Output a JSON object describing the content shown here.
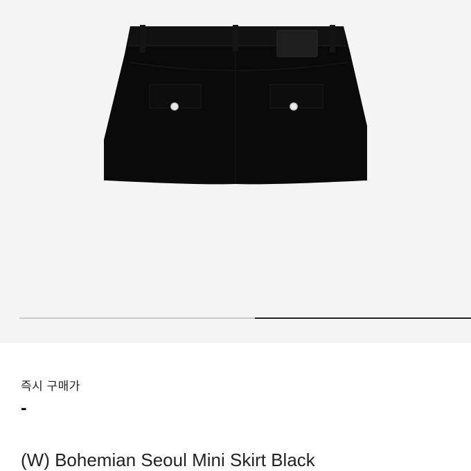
{
  "product": {
    "image_alt": "Black mini skirt, back view",
    "price_label": "즉시 구매가",
    "price_value": "-",
    "name": "(W) Bohemian Seoul Mini Skirt Black"
  },
  "carousel": {
    "current_slide": 2,
    "total_slides": 2
  },
  "colors": {
    "image_background": "#f4f4f4",
    "skirt": "#0a0a0a",
    "indicator_active": "#222222",
    "indicator_track": "#c9c9c9"
  }
}
